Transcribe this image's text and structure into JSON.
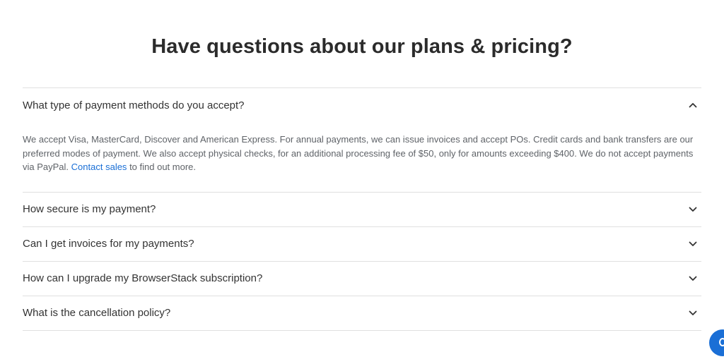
{
  "heading": "Have questions about our plans & pricing?",
  "faq": [
    {
      "question": "What type of payment methods do you accept?",
      "expanded": true,
      "answer": {
        "text_before_link": "We accept Visa, MasterCard, Discover and American Express. For annual payments, we can issue invoices and accept POs. Credit cards and bank transfers are our preferred modes of payment. We also accept physical checks, for an additional processing fee of $50, only for amounts exceeding $400. We do not accept payments via PayPal.",
        "link_text": "Contact sales",
        "text_after_link": "to find out more."
      }
    },
    {
      "question": "How secure is my payment?",
      "expanded": false
    },
    {
      "question": "Can I get invoices for my payments?",
      "expanded": false
    },
    {
      "question": "How can I upgrade my BrowserStack subscription?",
      "expanded": false
    },
    {
      "question": "What is the cancellation policy?",
      "expanded": false
    }
  ],
  "icons": {
    "expanded": "chevron-up-icon",
    "collapsed": "chevron-down-icon",
    "chat": "chat-icon"
  },
  "colors": {
    "link": "#1a6fd6",
    "chat_button": "#1a6fd6",
    "divider": "#e0e0e0"
  }
}
